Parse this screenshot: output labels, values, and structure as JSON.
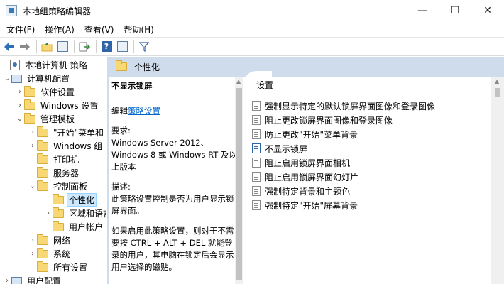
{
  "window": {
    "title": "本地组策略编辑器",
    "controls": {
      "minimize": "—",
      "maximize": "☐",
      "close": "✕"
    }
  },
  "menu": [
    "文件(F)",
    "操作(A)",
    "查看(V)",
    "帮助(H)"
  ],
  "toolbar": {
    "back_icon": "back-arrow-icon",
    "forward_icon": "forward-arrow-icon",
    "filter_icon": "filter-icon"
  },
  "tree": [
    {
      "label": "本地计算机 策略",
      "icon": "policy",
      "expander": "",
      "level": 0
    },
    {
      "label": "计算机配置",
      "icon": "computer",
      "expander": "⌄",
      "level": 1
    },
    {
      "label": "软件设置",
      "icon": "folder",
      "expander": "›",
      "level": 2
    },
    {
      "label": "Windows 设置",
      "icon": "folder",
      "expander": "›",
      "level": 2
    },
    {
      "label": "管理模板",
      "icon": "folder",
      "expander": "⌄",
      "level": 2
    },
    {
      "label": "\"开始\"菜单和",
      "icon": "folder",
      "expander": "›",
      "level": 3
    },
    {
      "label": "Windows 组",
      "icon": "folder",
      "expander": "›",
      "level": 3
    },
    {
      "label": "打印机",
      "icon": "folder",
      "expander": "",
      "level": 3
    },
    {
      "label": "服务器",
      "icon": "folder",
      "expander": "",
      "level": 3
    },
    {
      "label": "控制面板",
      "icon": "folder",
      "expander": "⌄",
      "level": 3
    },
    {
      "label": "个性化",
      "icon": "folder-open",
      "expander": "",
      "level": 4,
      "selected": true
    },
    {
      "label": "区域和语言",
      "icon": "folder",
      "expander": "›",
      "level": 4
    },
    {
      "label": "用户帐户",
      "icon": "folder",
      "expander": "",
      "level": 4
    },
    {
      "label": "网络",
      "icon": "folder",
      "expander": "›",
      "level": 3
    },
    {
      "label": "系统",
      "icon": "folder",
      "expander": "›",
      "level": 3
    },
    {
      "label": "所有设置",
      "icon": "folder",
      "expander": "",
      "level": 3
    },
    {
      "label": "用户配置",
      "icon": "computer",
      "expander": "›",
      "level": 1
    }
  ],
  "content": {
    "header": "个性化",
    "extended": {
      "title": "不显示锁屏",
      "edit_prefix": "编辑",
      "edit_link": "策略设置",
      "requirements_label": "要求:",
      "requirements_text": "Windows Server 2012、Windows 8 或 Windows RT 及以上版本",
      "description_label": "描述:",
      "description_text": "此策略设置控制是否为用户显示锁屏界面。",
      "detail_text": "如果启用此策略设置，则对于不需要按 CTRL + ALT + DEL 就能登录的用户，其电脑在锁定后会显示用户选择的磁贴。"
    },
    "list_header": "设置",
    "settings": [
      {
        "label": "强制显示特定的默认锁屏界面图像和登录图像"
      },
      {
        "label": "阻止更改锁屏界面图像和登录图像"
      },
      {
        "label": "防止更改\"开始\"菜单背景"
      },
      {
        "label": "不显示锁屏",
        "selected": true
      },
      {
        "label": "阻止启用锁屏界面相机"
      },
      {
        "label": "阻止启用锁屏界面幻灯片"
      },
      {
        "label": "强制特定背景和主题色"
      },
      {
        "label": "强制特定\"开始\"屏幕背景"
      }
    ]
  }
}
